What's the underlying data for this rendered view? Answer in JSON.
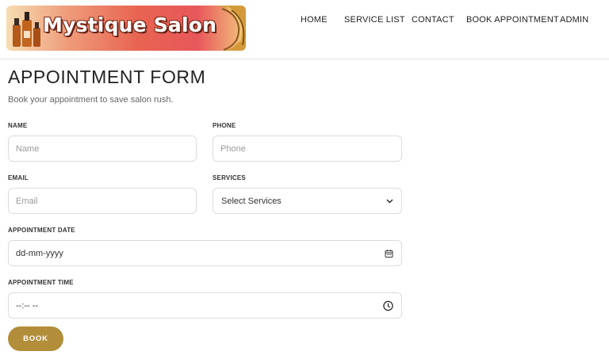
{
  "brand": {
    "name": "Mystique Salon"
  },
  "nav": {
    "items": [
      "HOME",
      "SERVICE LIST",
      "CONTACT",
      "BOOK APPOINTMENT",
      "ADMIN"
    ]
  },
  "form": {
    "title": "APPOINTMENT FORM",
    "subtitle": "Book your appointment to save salon rush.",
    "name": {
      "label": "NAME",
      "placeholder": "Name",
      "value": ""
    },
    "phone": {
      "label": "PHONE",
      "placeholder": "Phone",
      "value": ""
    },
    "email": {
      "label": "EMAIL",
      "placeholder": "Email",
      "value": ""
    },
    "services": {
      "label": "SERVICES",
      "selected": "Select Services"
    },
    "date": {
      "label": "APPOINTMENT DATE",
      "value": "dd-mm-yyyy",
      "icon": "calendar-icon"
    },
    "time": {
      "label": "APPOINTMENT TIME",
      "value": "--:-- --",
      "icon": "clock-icon"
    },
    "submit_label": "BOOK"
  },
  "colors": {
    "accent": "#b28e3a",
    "logo_red": "#e8575b",
    "border": "#dcdcdc"
  }
}
